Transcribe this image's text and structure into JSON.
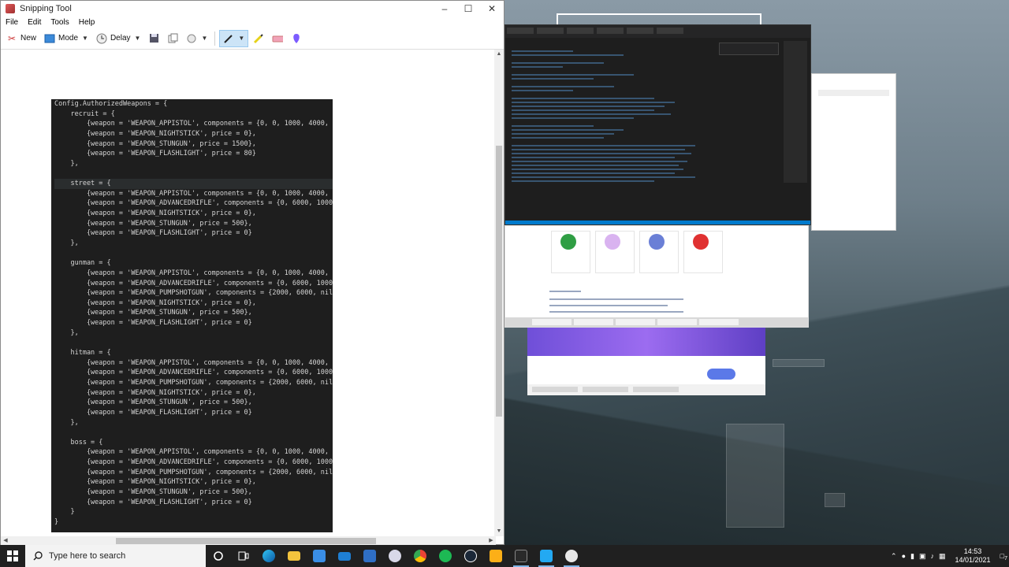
{
  "window": {
    "title": "Snipping Tool"
  },
  "menu": [
    "File",
    "Edit",
    "Tools",
    "Help"
  ],
  "toolbar": {
    "new": "New",
    "mode": "Mode",
    "delay": "Delay"
  },
  "code_lines": [
    "Config.AuthorizedWeapons = {",
    "    recruit = {",
    "        {weapon = 'WEAPON_APPISTOL', components = {0, 0, 1000, 4000,",
    "        {weapon = 'WEAPON_NIGHTSTICK', price = 0},",
    "        {weapon = 'WEAPON_STUNGUN', price = 1500},",
    "        {weapon = 'WEAPON_FLASHLIGHT', price = 80}",
    "    },",
    "",
    "    street = {",
    "        {weapon = 'WEAPON_APPISTOL', components = {0, 0, 1000, 4000,",
    "        {weapon = 'WEAPON_ADVANCEDRIFLE', components = {0, 6000, 1000",
    "        {weapon = 'WEAPON_NIGHTSTICK', price = 0},",
    "        {weapon = 'WEAPON_STUNGUN', price = 500},",
    "        {weapon = 'WEAPON_FLASHLIGHT', price = 0}",
    "    },",
    "",
    "    gunman = {",
    "        {weapon = 'WEAPON_APPISTOL', components = {0, 0, 1000, 4000,",
    "        {weapon = 'WEAPON_ADVANCEDRIFLE', components = {0, 6000, 1000",
    "        {weapon = 'WEAPON_PUMPSHOTGUN', components = {2000, 6000, nil",
    "        {weapon = 'WEAPON_NIGHTSTICK', price = 0},",
    "        {weapon = 'WEAPON_STUNGUN', price = 500},",
    "        {weapon = 'WEAPON_FLASHLIGHT', price = 0}",
    "    },",
    "",
    "    hitman = {",
    "        {weapon = 'WEAPON_APPISTOL', components = {0, 0, 1000, 4000,",
    "        {weapon = 'WEAPON_ADVANCEDRIFLE', components = {0, 6000, 1000",
    "        {weapon = 'WEAPON_PUMPSHOTGUN', components = {2000, 6000, nil",
    "        {weapon = 'WEAPON_NIGHTSTICK', price = 0},",
    "        {weapon = 'WEAPON_STUNGUN', price = 500},",
    "        {weapon = 'WEAPON_FLASHLIGHT', price = 0}",
    "    },",
    "",
    "    boss = {",
    "        {weapon = 'WEAPON_APPISTOL', components = {0, 0, 1000, 4000,",
    "        {weapon = 'WEAPON_ADVANCEDRIFLE', components = {0, 6000, 1000",
    "        {weapon = 'WEAPON_PUMPSHOTGUN', components = {2000, 6000, nil",
    "        {weapon = 'WEAPON_NIGHTSTICK', price = 0},",
    "        {weapon = 'WEAPON_STUNGUN', price = 500},",
    "        {weapon = 'WEAPON_FLASHLIGHT', price = 0}",
    "    }",
    "}"
  ],
  "taskbar": {
    "search_placeholder": "Type here to search",
    "time": "14:53",
    "date": "14/01/2021",
    "notification_count": "7"
  },
  "colors": {
    "code_bg": "#1e1e1e",
    "code_text": "#d4d4d4",
    "accent": "#0078d7",
    "taskbar_bg": "#202020"
  }
}
